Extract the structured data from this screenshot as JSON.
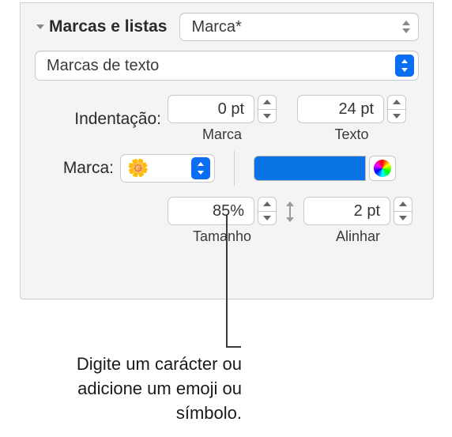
{
  "header": {
    "title": "Marcas e listas",
    "style_value": "Marca*"
  },
  "bullet_type": {
    "value": "Marcas de texto"
  },
  "indent": {
    "label": "Indentação:",
    "marca": {
      "value": "0 pt",
      "sublabel": "Marca"
    },
    "texto": {
      "value": "24 pt",
      "sublabel": "Texto"
    }
  },
  "marca": {
    "label": "Marca:",
    "emoji": "🌼",
    "swatch_color": "#0a73e6"
  },
  "size": {
    "value": "85%",
    "sublabel": "Tamanho"
  },
  "align": {
    "value": "2 pt",
    "sublabel": "Alinhar"
  },
  "callout": {
    "text": "Digite um carácter ou adicione um emoji ou símbolo."
  }
}
